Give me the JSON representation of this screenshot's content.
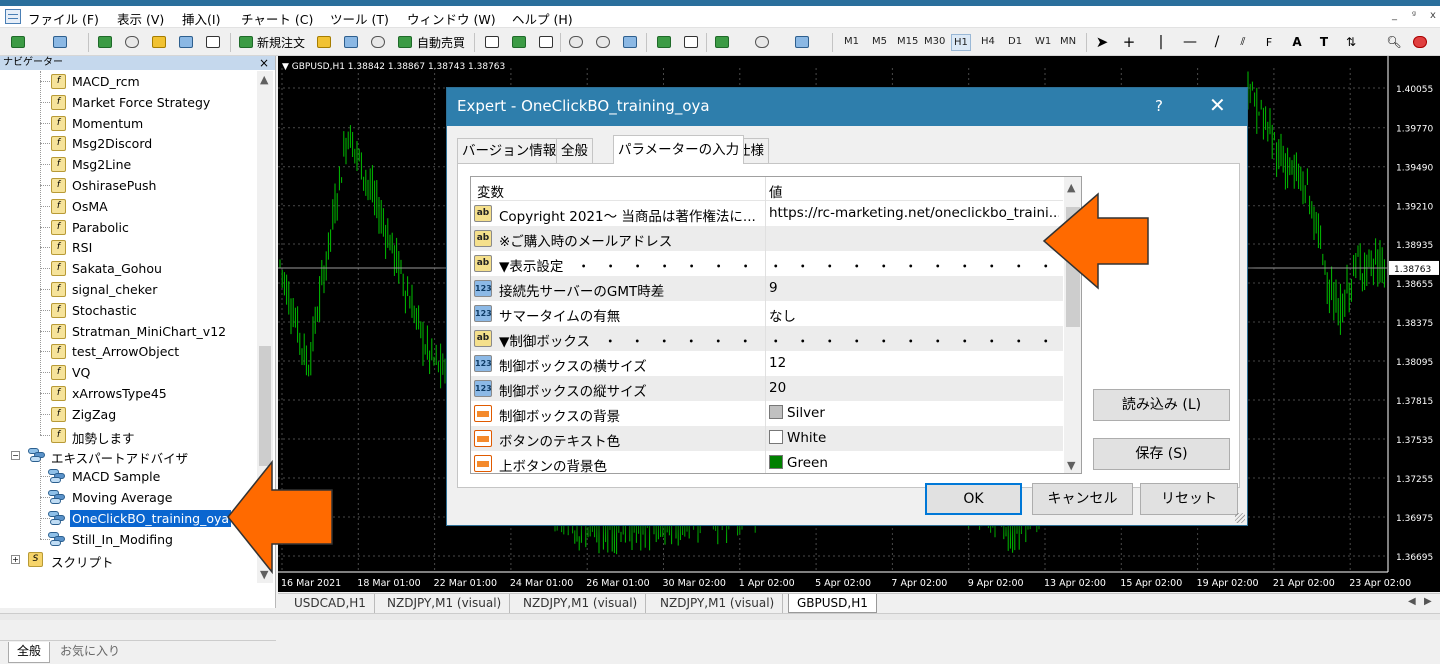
{
  "menu": {
    "items": [
      "ファイル (F)",
      "表示 (V)",
      "挿入(I)",
      "チャート (C)",
      "ツール (T)",
      "ウィンドウ (W)",
      "ヘルプ (H)"
    ],
    "window_controls": [
      "_",
      "ᵍ",
      "x"
    ]
  },
  "toolbar": {
    "new_order": "新規注文",
    "auto_trading": "自動売買",
    "timeframes": [
      "M1",
      "M5",
      "M15",
      "M30",
      "H1",
      "H4",
      "D1",
      "W1",
      "MN"
    ],
    "active_timeframe": "H1",
    "drawing_text_a": "A",
    "drawing_text_t": "T"
  },
  "navigator": {
    "title": "ナビゲーター",
    "close": "×",
    "indicators": [
      "MACD_rcm",
      "Market Force Strategy",
      "Momentum",
      "Msg2Discord",
      "Msg2Line",
      "OshirasePush",
      "OsMA",
      "Parabolic",
      "RSI",
      "Sakata_Gohou",
      "signal_cheker",
      "Stochastic",
      "Stratman_MiniChart_v12",
      "test_ArrowObject",
      "VQ",
      "xArrowsType45",
      "ZigZag",
      "加勢します"
    ],
    "expert_folder": "エキスパートアドバイザ",
    "experts": [
      "MACD Sample",
      "Moving Average",
      "OneClickBO_training_oya",
      "Still_In_Modifing"
    ],
    "selected_expert": "OneClickBO_training_oya",
    "scripts_folder": "スクリプト",
    "tabs": [
      "全般",
      "お気に入り"
    ]
  },
  "chart": {
    "header": "GBPUSD,H1  1.38842 1.38867 1.38743 1.38763",
    "price_labels": [
      "1.40055",
      "1.39770",
      "1.39490",
      "1.39210",
      "1.38935",
      "1.38655",
      "1.38375",
      "1.38095",
      "1.37815",
      "1.37535",
      "1.37255",
      "1.36975",
      "1.36695"
    ],
    "current_price": "1.38763",
    "date_labels": [
      "16 Mar 2021",
      "18 Mar 01:00",
      "22 Mar 01:00",
      "24 Mar 01:00",
      "26 Mar 01:00",
      "30 Mar 02:00",
      "1 Apr 02:00",
      "5 Apr 02:00",
      "7 Apr 02:00",
      "9 Apr 02:00",
      "13 Apr 02:00",
      "15 Apr 02:00",
      "19 Apr 02:00",
      "21 Apr 02:00",
      "23 Apr 02:00"
    ],
    "price_colors": {
      "background": "#000000",
      "candles": "#00c000",
      "grid": "#4a4a4a",
      "text": "#ffffff"
    }
  },
  "chart_tabs": [
    "USDCAD,H1",
    "NZDJPY,M1 (visual)",
    "NZDJPY,M1 (visual)",
    "NZDJPY,M1 (visual)",
    "GBPUSD,H1"
  ],
  "chart_tab_active": "GBPUSD,H1",
  "dialog": {
    "title": "Expert - OneClickBO_training_oya",
    "help": "?",
    "close": "✕",
    "tabs": [
      "バージョン情報",
      "全般",
      "パラメーターの入力",
      "仕様"
    ],
    "active_tab": "パラメーターの入力",
    "col_variable": "変数",
    "col_value": "値",
    "params": [
      {
        "icon": "ab",
        "name": "Copyright 2021～ 当商品は著作権法に...",
        "value": "https://rc-marketing.net/oneclickbo_traini..."
      },
      {
        "icon": "ab",
        "name": "※ご購入時のメールアドレス",
        "value": ""
      },
      {
        "icon": "ab",
        "name": "▼表示設定　・　・　・　・　・　・　・　・",
        "value": "・　・　・　・　・　・　・　・　・　・　・　・　・　..."
      },
      {
        "icon": "123",
        "name": "接続先サーバーのGMT時差",
        "value": "9"
      },
      {
        "icon": "123",
        "name": "サマータイムの有無",
        "value": "なし"
      },
      {
        "icon": "ab",
        "name": "▼制御ボックス　・　・　・　・　・　・　..",
        "value": "・　・　・　・　・　・　・　・　・　・　・　・　・　..."
      },
      {
        "icon": "123",
        "name": "制御ボックスの横サイズ",
        "value": "12"
      },
      {
        "icon": "123",
        "name": "制御ボックスの縦サイズ",
        "value": "20"
      },
      {
        "icon": "color",
        "name": "制御ボックスの背景",
        "value": "Silver",
        "swatch": "#c0c0c0"
      },
      {
        "icon": "color",
        "name": "ボタンのテキスト色",
        "value": "White",
        "swatch": "#ffffff"
      },
      {
        "icon": "color",
        "name": "上ボタンの背景色",
        "value": "Green",
        "swatch": "#008000"
      }
    ],
    "load_button": "読み込み (L)",
    "save_button": "保存 (S)",
    "ok_button": "OK",
    "cancel_button": "キャンセル",
    "reset_button": "リセット"
  },
  "annotation_colors": {
    "arrow": "#ff6a00"
  }
}
